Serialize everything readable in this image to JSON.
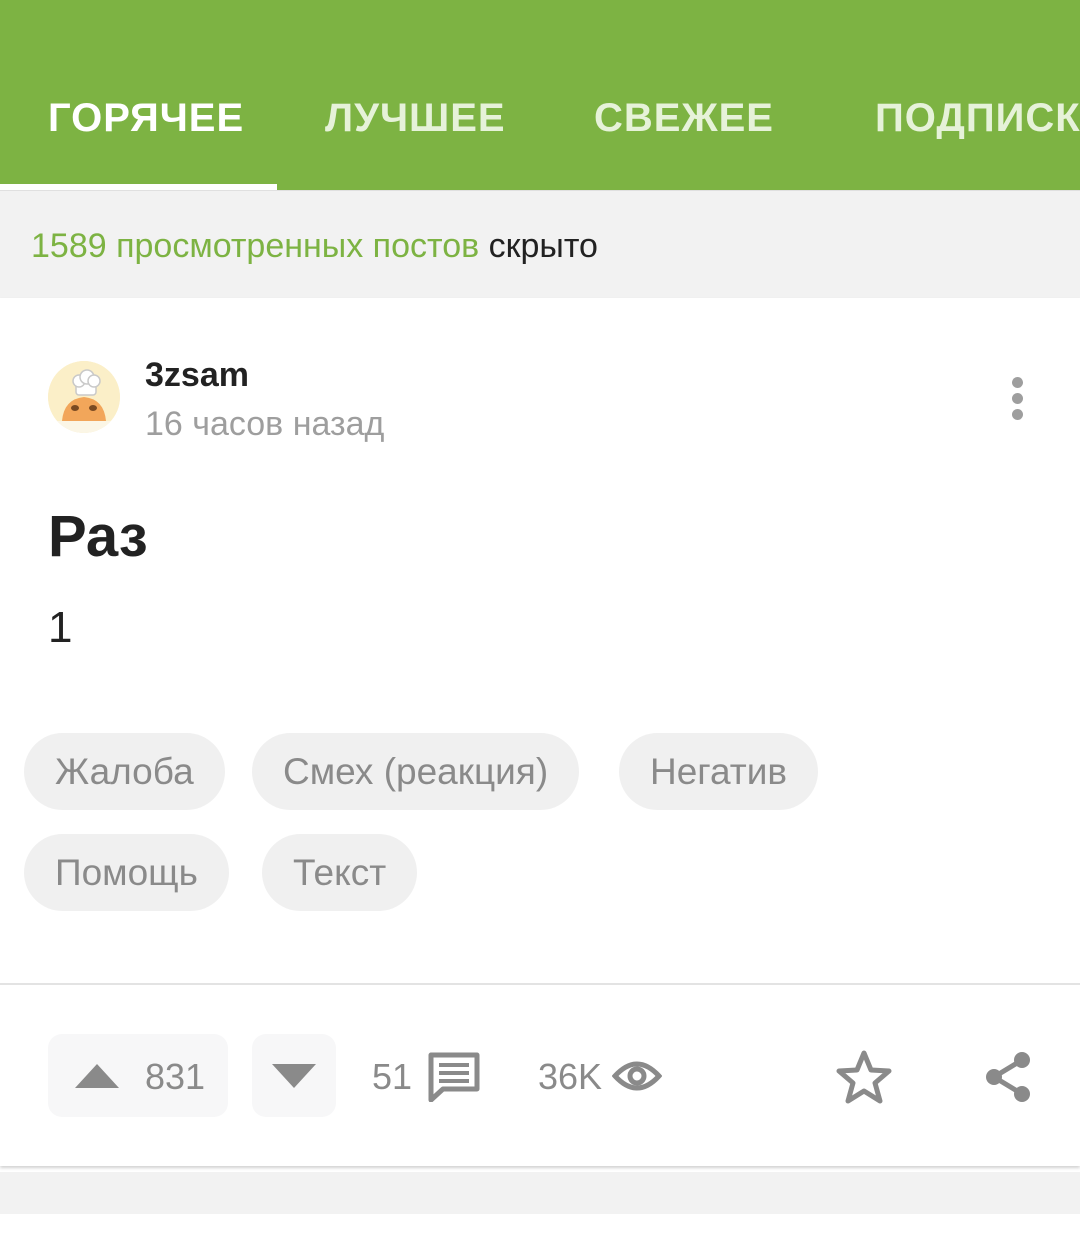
{
  "tabs": [
    {
      "label": "ГОРЯЧЕЕ",
      "active": true
    },
    {
      "label": "ЛУЧШЕЕ",
      "active": false
    },
    {
      "label": "СВЕЖЕЕ",
      "active": false
    },
    {
      "label": "ПОДПИСКИ",
      "active": false
    }
  ],
  "hidden_posts": {
    "count_text": "1589 просмотренных постов",
    "action_text": "скрыто"
  },
  "post": {
    "author": "3zsam",
    "time": "16 часов назад",
    "title": "Раз",
    "body": "1",
    "tags": [
      "Жалоба",
      "Смех (реакция)",
      "Негатив",
      "Помощь",
      "Текст"
    ],
    "rating": "831",
    "comments": "51",
    "views": "36K"
  },
  "icons": {
    "upvote": "triangle-up-icon",
    "downvote": "triangle-down-icon",
    "comments": "comment-icon",
    "views": "eye-icon",
    "save": "star-icon",
    "share": "share-icon",
    "more": "more-vertical-icon"
  },
  "colors": {
    "brand": "#7db343",
    "tag_bg": "#f0f0f0",
    "muted": "#8a8a8a"
  }
}
